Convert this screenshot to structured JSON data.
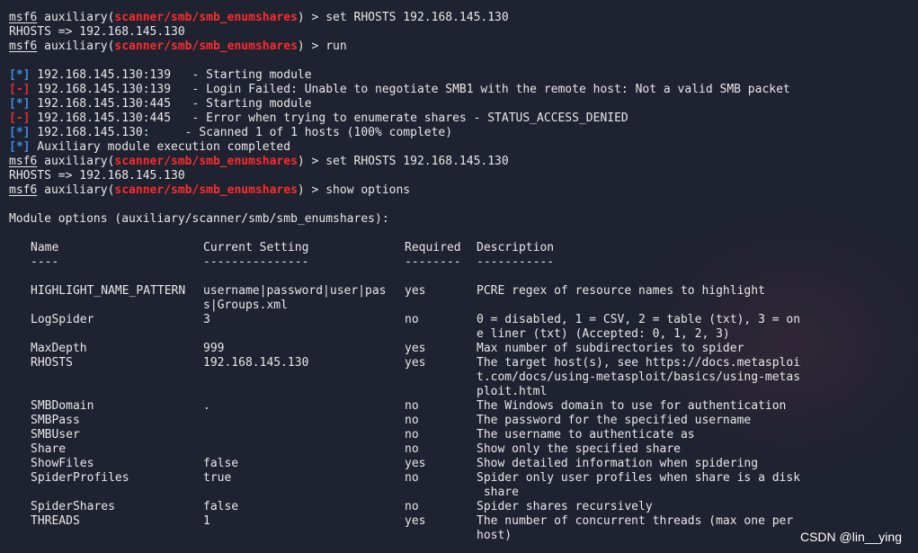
{
  "prompt": {
    "msf": "msf6",
    "aux_prefix": " auxiliary(",
    "module": "scanner/smb/smb_enumshares",
    "suffix": ") > "
  },
  "commands": {
    "set_rhosts": "set RHOSTS 192.168.145.130",
    "run": "run",
    "show_options": "show options"
  },
  "outputs": {
    "rhosts_echo": "RHOSTS => 192.168.145.130",
    "module_options_header": "Module options (auxiliary/scanner/smb/smb_enumshares):"
  },
  "run_output": [
    {
      "tag": "[*]",
      "type": "info",
      "text": " 192.168.145.130:139   - Starting module"
    },
    {
      "tag": "[-]",
      "type": "error",
      "text": " 192.168.145.130:139   - Login Failed: Unable to negotiate SMB1 with the remote host: Not a valid SMB packet"
    },
    {
      "tag": "[*]",
      "type": "info",
      "text": " 192.168.145.130:445   - Starting module"
    },
    {
      "tag": "[-]",
      "type": "error",
      "text": " 192.168.145.130:445   - Error when trying to enumerate shares - STATUS_ACCESS_DENIED"
    },
    {
      "tag": "[*]",
      "type": "info",
      "text": " 192.168.145.130:     - Scanned 1 of 1 hosts (100% complete)"
    },
    {
      "tag": "[*]",
      "type": "info",
      "text": " Auxiliary module execution completed"
    }
  ],
  "options_table": {
    "headers": {
      "name": "Name",
      "setting": "Current Setting",
      "required": "Required",
      "description": "Description"
    },
    "underlines": {
      "name": "----",
      "setting": "---------------",
      "required": "--------",
      "description": "-----------"
    },
    "rows": [
      {
        "name": [
          "HIGHLIGHT_NAME_PATTERN",
          ""
        ],
        "setting": [
          "username|password|user|pas",
          "s|Groups.xml"
        ],
        "required": [
          "yes",
          ""
        ],
        "description": [
          "PCRE regex of resource names to highlight",
          ""
        ]
      },
      {
        "name": [
          "LogSpider",
          ""
        ],
        "setting": [
          "3",
          ""
        ],
        "required": [
          "no",
          ""
        ],
        "description": [
          "0 = disabled, 1 = CSV, 2 = table (txt), 3 = on",
          "e liner (txt) (Accepted: 0, 1, 2, 3)"
        ]
      },
      {
        "name": [
          "MaxDepth"
        ],
        "setting": [
          "999"
        ],
        "required": [
          "yes"
        ],
        "description": [
          "Max number of subdirectories to spider"
        ]
      },
      {
        "name": [
          "RHOSTS",
          "",
          ""
        ],
        "setting": [
          "192.168.145.130",
          "",
          ""
        ],
        "required": [
          "yes",
          "",
          ""
        ],
        "description": [
          "The target host(s), see https://docs.metasploi",
          "t.com/docs/using-metasploit/basics/using-metas",
          "ploit.html"
        ]
      },
      {
        "name": [
          "SMBDomain"
        ],
        "setting": [
          "."
        ],
        "required": [
          "no"
        ],
        "description": [
          "The Windows domain to use for authentication"
        ]
      },
      {
        "name": [
          "SMBPass"
        ],
        "setting": [
          ""
        ],
        "required": [
          "no"
        ],
        "description": [
          "The password for the specified username"
        ]
      },
      {
        "name": [
          "SMBUser"
        ],
        "setting": [
          ""
        ],
        "required": [
          "no"
        ],
        "description": [
          "The username to authenticate as"
        ]
      },
      {
        "name": [
          "Share"
        ],
        "setting": [
          ""
        ],
        "required": [
          "no"
        ],
        "description": [
          "Show only the specified share"
        ]
      },
      {
        "name": [
          "ShowFiles"
        ],
        "setting": [
          "false"
        ],
        "required": [
          "yes"
        ],
        "description": [
          "Show detailed information when spidering"
        ]
      },
      {
        "name": [
          "SpiderProfiles",
          ""
        ],
        "setting": [
          "true",
          ""
        ],
        "required": [
          "no",
          ""
        ],
        "description": [
          "Spider only user profiles when share is a disk",
          " share"
        ]
      },
      {
        "name": [
          "SpiderShares"
        ],
        "setting": [
          "false"
        ],
        "required": [
          "no"
        ],
        "description": [
          "Spider shares recursively"
        ]
      },
      {
        "name": [
          "THREADS",
          ""
        ],
        "setting": [
          "1",
          ""
        ],
        "required": [
          "yes",
          ""
        ],
        "description": [
          "The number of concurrent threads (max one per",
          "host)"
        ]
      }
    ]
  },
  "watermark": "CSDN @lin__ying",
  "colors": {
    "background": "#1f2230",
    "module_red": "#ff2b2b",
    "info_blue": "#3b8eea",
    "error_red": "#e0302f",
    "text": "#e8e8e8"
  }
}
